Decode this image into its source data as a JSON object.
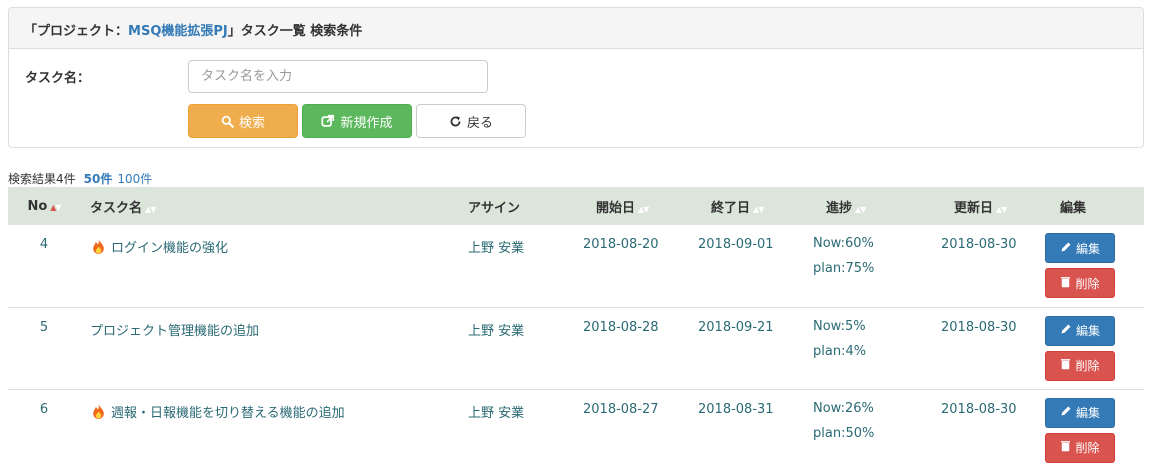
{
  "header": {
    "prefix": "「プロジェクト：",
    "project": "MSQ機能拡張PJ",
    "suffix": "」タスク一覧 検索条件"
  },
  "search": {
    "task_label": "タスク名：",
    "placeholder": "タスク名を入力",
    "search_label": "検索",
    "new_label": "新規作成",
    "back_label": "戻る"
  },
  "results": {
    "count_text": "検索結果4件",
    "per50": "50件",
    "per100": "100件"
  },
  "columns": {
    "no": "No",
    "task": "タスク名",
    "assignee": "アサイン",
    "start": "開始日",
    "end": "終了日",
    "progress": "進捗",
    "updated": "更新日",
    "edit": "編集"
  },
  "rows": [
    {
      "no": "4",
      "hot": true,
      "task": "ログイン機能の強化",
      "assignee": "上野 安業",
      "start": "2018-08-20",
      "end": "2018-09-01",
      "now": "Now:60%",
      "plan": "plan:75%",
      "updated": "2018-08-30",
      "edit_label": "編集",
      "delete_label": "削除"
    },
    {
      "no": "5",
      "hot": false,
      "task": "プロジェクト管理機能の追加",
      "assignee": "上野 安業",
      "start": "2018-08-28",
      "end": "2018-09-21",
      "now": "Now:5%",
      "plan": "plan:4%",
      "updated": "2018-08-30",
      "edit_label": "編集",
      "delete_label": "削除"
    },
    {
      "no": "6",
      "hot": true,
      "task": "週報・日報機能を切り替える機能の追加",
      "assignee": "上野 安業",
      "start": "2018-08-27",
      "end": "2018-08-31",
      "now": "Now:26%",
      "plan": "plan:50%",
      "updated": "2018-08-30",
      "edit_label": "編集",
      "delete_label": "削除"
    }
  ],
  "colors": {
    "accent": "#337ab7",
    "warning": "#f0ad4e",
    "success": "#5cb85c",
    "danger": "#d9534f",
    "table_header": "#dbe5da"
  },
  "icons": {
    "search": "search-icon",
    "new": "external-link-icon",
    "back": "refresh-icon",
    "hot": "fire-icon",
    "edit": "pencil-icon",
    "delete": "trash-icon"
  }
}
